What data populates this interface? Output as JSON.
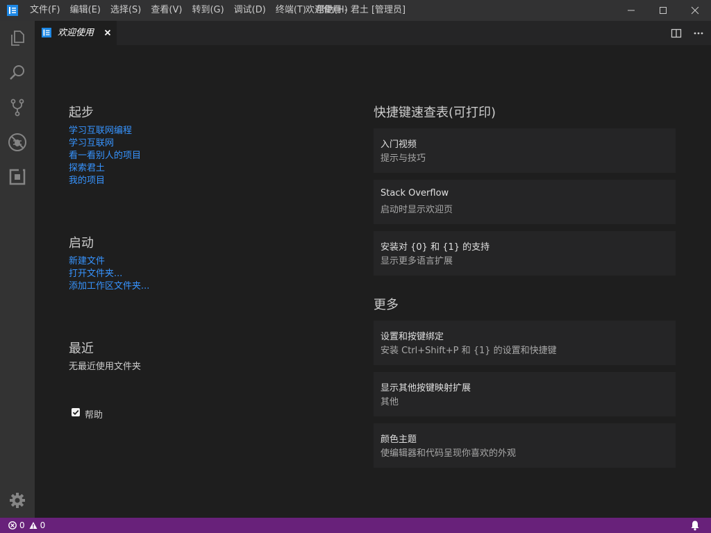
{
  "menu": {
    "items": [
      "文件(F)",
      "编辑(E)",
      "选择(S)",
      "查看(V)",
      "转到(G)",
      "调试(D)",
      "终端(T)",
      "帮助(H)"
    ]
  },
  "window": {
    "title": "欢迎使用 - 君土 [管理员]"
  },
  "tab": {
    "label": "欢迎使用"
  },
  "start": {
    "title": "起步",
    "links": [
      "学习互联网编程",
      "学习互联网",
      "看一看别人的项目",
      "探索君土",
      "我的项目"
    ]
  },
  "launch": {
    "title": "启动",
    "links": [
      "新建文件",
      "打开文件夹...",
      "添加工作区文件夹..."
    ]
  },
  "recent": {
    "title": "最近",
    "empty": "无最近使用文件夹"
  },
  "help": {
    "checkbox_label": "帮助",
    "checked": true
  },
  "shortcuts": {
    "title": "快捷键速查表(可打印)",
    "cards": [
      {
        "title": "入门视频",
        "desc": "提示与技巧"
      },
      {
        "title": "Stack Overflow",
        "desc": "启动时显示欢迎页"
      },
      {
        "title": "安装对 {0} 和 {1} 的支持",
        "desc": "显示更多语言扩展"
      }
    ]
  },
  "more": {
    "title": "更多",
    "cards": [
      {
        "title": "设置和按键绑定",
        "desc": "安装 Ctrl+Shift+P 和 {1} 的设置和快捷键"
      },
      {
        "title": "显示其他按键映射扩展",
        "desc": "其他"
      },
      {
        "title": "颜色主题",
        "desc": "使编辑器和代码呈现你喜欢的外观"
      }
    ]
  },
  "status": {
    "errors": "0",
    "warnings": "0"
  },
  "colors": {
    "accent": "#68217a",
    "link": "#3794ff",
    "logo": "#1e88e5"
  }
}
